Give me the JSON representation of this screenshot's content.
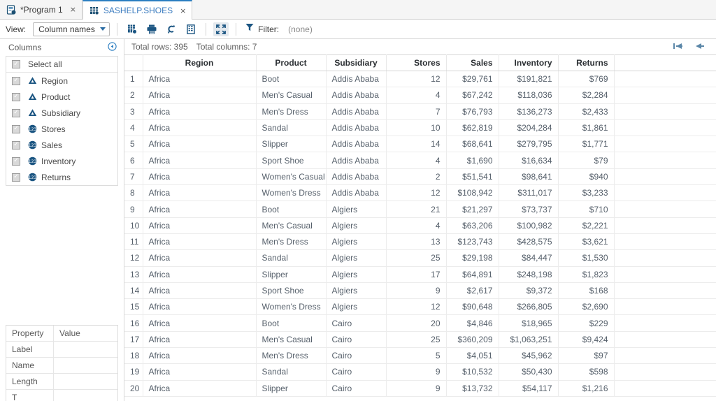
{
  "tabs": [
    {
      "label": "*Program 1",
      "icon": "program-icon",
      "active": false,
      "close": "×"
    },
    {
      "label": "SASHELP.SHOES",
      "icon": "table-icon",
      "active": true,
      "close": "×"
    }
  ],
  "toolbar": {
    "view_label": "View:",
    "view_value": "Column names",
    "buttons": [
      {
        "name": "export-data-icon",
        "title": "Export data"
      },
      {
        "name": "print-icon",
        "title": "Print"
      },
      {
        "name": "refresh-icon",
        "title": "Refresh"
      },
      {
        "name": "column-properties-icon",
        "title": "Column properties"
      }
    ],
    "maximize": {
      "name": "maximize-icon",
      "title": "Maximize view",
      "pressed": true
    },
    "filter_label": "Filter:",
    "filter_value": "(none)"
  },
  "columns_panel": {
    "title": "Columns",
    "collapse_icon": "collapse-left-icon",
    "select_all": "Select all",
    "items": [
      {
        "label": "Region",
        "type": "char",
        "checked": true
      },
      {
        "label": "Product",
        "type": "char",
        "checked": true
      },
      {
        "label": "Subsidiary",
        "type": "char",
        "checked": true
      },
      {
        "label": "Stores",
        "type": "num",
        "checked": true
      },
      {
        "label": "Sales",
        "type": "num",
        "checked": true
      },
      {
        "label": "Inventory",
        "type": "num",
        "checked": true
      },
      {
        "label": "Returns",
        "type": "num",
        "checked": true
      }
    ]
  },
  "properties": {
    "headers": [
      "Property",
      "Value"
    ],
    "rows": [
      {
        "key": "Label",
        "value": ""
      },
      {
        "key": "Name",
        "value": ""
      },
      {
        "key": "Length",
        "value": ""
      },
      {
        "key": "T",
        "value": ""
      }
    ]
  },
  "summary": {
    "total_rows": "Total rows: 395",
    "total_columns": "Total columns: 7"
  },
  "pager": {
    "first": "go-to-first-page-icon",
    "previous": "go-to-previous-page-icon"
  },
  "table": {
    "headers": [
      "",
      "Region",
      "Product",
      "Subsidiary",
      "Stores",
      "Sales",
      "Inventory",
      "Returns",
      ""
    ],
    "rows": [
      [
        "1",
        "Africa",
        "Boot",
        "Addis Ababa",
        "12",
        "$29,761",
        "$191,821",
        "$769"
      ],
      [
        "2",
        "Africa",
        "Men's Casual",
        "Addis Ababa",
        "4",
        "$67,242",
        "$118,036",
        "$2,284"
      ],
      [
        "3",
        "Africa",
        "Men's Dress",
        "Addis Ababa",
        "7",
        "$76,793",
        "$136,273",
        "$2,433"
      ],
      [
        "4",
        "Africa",
        "Sandal",
        "Addis Ababa",
        "10",
        "$62,819",
        "$204,284",
        "$1,861"
      ],
      [
        "5",
        "Africa",
        "Slipper",
        "Addis Ababa",
        "14",
        "$68,641",
        "$279,795",
        "$1,771"
      ],
      [
        "6",
        "Africa",
        "Sport Shoe",
        "Addis Ababa",
        "4",
        "$1,690",
        "$16,634",
        "$79"
      ],
      [
        "7",
        "Africa",
        "Women's Casual",
        "Addis Ababa",
        "2",
        "$51,541",
        "$98,641",
        "$940"
      ],
      [
        "8",
        "Africa",
        "Women's Dress",
        "Addis Ababa",
        "12",
        "$108,942",
        "$311,017",
        "$3,233"
      ],
      [
        "9",
        "Africa",
        "Boot",
        "Algiers",
        "21",
        "$21,297",
        "$73,737",
        "$710"
      ],
      [
        "10",
        "Africa",
        "Men's Casual",
        "Algiers",
        "4",
        "$63,206",
        "$100,982",
        "$2,221"
      ],
      [
        "11",
        "Africa",
        "Men's Dress",
        "Algiers",
        "13",
        "$123,743",
        "$428,575",
        "$3,621"
      ],
      [
        "12",
        "Africa",
        "Sandal",
        "Algiers",
        "25",
        "$29,198",
        "$84,447",
        "$1,530"
      ],
      [
        "13",
        "Africa",
        "Slipper",
        "Algiers",
        "17",
        "$64,891",
        "$248,198",
        "$1,823"
      ],
      [
        "14",
        "Africa",
        "Sport Shoe",
        "Algiers",
        "9",
        "$2,617",
        "$9,372",
        "$168"
      ],
      [
        "15",
        "Africa",
        "Women's Dress",
        "Algiers",
        "12",
        "$90,648",
        "$266,805",
        "$2,690"
      ],
      [
        "16",
        "Africa",
        "Boot",
        "Cairo",
        "20",
        "$4,846",
        "$18,965",
        "$229"
      ],
      [
        "17",
        "Africa",
        "Men's Casual",
        "Cairo",
        "25",
        "$360,209",
        "$1,063,251",
        "$9,424"
      ],
      [
        "18",
        "Africa",
        "Men's Dress",
        "Cairo",
        "5",
        "$4,051",
        "$45,962",
        "$97"
      ],
      [
        "19",
        "Africa",
        "Sandal",
        "Cairo",
        "9",
        "$10,532",
        "$50,430",
        "$598"
      ],
      [
        "20",
        "Africa",
        "Slipper",
        "Cairo",
        "9",
        "$13,732",
        "$54,117",
        "$1,216"
      ]
    ]
  },
  "colors": {
    "accent": "#2b7ec1",
    "icon_dark": "#1b4f72",
    "text": "#56606b",
    "header_text": "#2b2f33"
  }
}
